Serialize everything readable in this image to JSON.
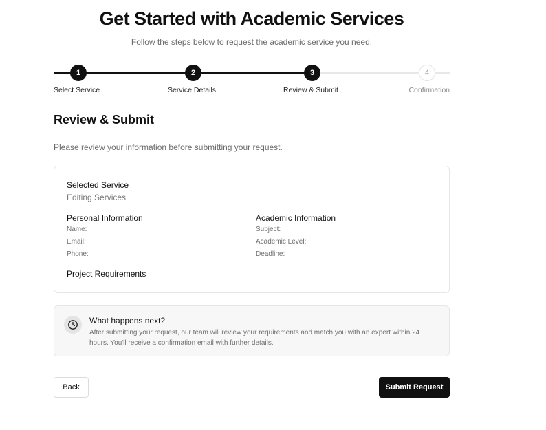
{
  "header": {
    "title": "Get Started with Academic Services",
    "subtitle": "Follow the steps below to request the academic service you need."
  },
  "stepper": {
    "current_step": 3,
    "steps": [
      {
        "number": "1",
        "label": "Select Service",
        "status": "completed"
      },
      {
        "number": "2",
        "label": "Service Details",
        "status": "completed"
      },
      {
        "number": "3",
        "label": "Review & Submit",
        "status": "current"
      },
      {
        "number": "4",
        "label": "Confirmation",
        "status": "upcoming"
      }
    ]
  },
  "section": {
    "title": "Review & Submit",
    "intro": "Please review your information before submitting your request."
  },
  "review": {
    "selected_service": {
      "title": "Selected Service",
      "value": "Editing Services"
    },
    "personal": {
      "title": "Personal Information",
      "name_label": "Name:",
      "email_label": "Email:",
      "phone_label": "Phone:"
    },
    "academic": {
      "title": "Academic Information",
      "subject_label": "Subject:",
      "level_label": "Academic Level:",
      "deadline_label": "Deadline:"
    },
    "requirements": {
      "title": "Project Requirements"
    }
  },
  "next": {
    "icon": "clock-icon",
    "title": "What happens next?",
    "text": "After submitting your request, our team will review your requirements and match you with an expert within 24 hours. You'll receive a confirmation email with further details."
  },
  "actions": {
    "back_label": "Back",
    "submit_label": "Submit Request"
  },
  "colors": {
    "primary": "#111111",
    "muted_text": "#6b6b6b",
    "border": "#e6e6e6",
    "info_bg": "#f7f7f7"
  }
}
